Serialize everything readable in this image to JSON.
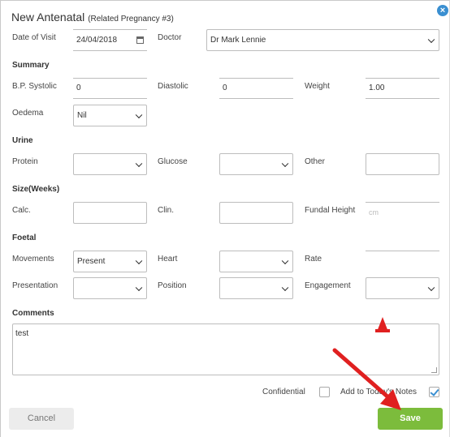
{
  "dialog": {
    "title": "New Antenatal",
    "subtitle": "(Related Pregnancy #3)"
  },
  "visit": {
    "date_label": "Date of Visit",
    "date_value": "24/04/2018",
    "doctor_label": "Doctor",
    "doctor_value": "Dr Mark Lennie"
  },
  "summary": {
    "heading": "Summary",
    "bp_label": "B.P. Systolic",
    "bp_value": "0",
    "diastolic_label": "Diastolic",
    "diastolic_value": "0",
    "weight_label": "Weight",
    "weight_value": "1.00",
    "oedema_label": "Oedema",
    "oedema_value": "Nil"
  },
  "urine": {
    "heading": "Urine",
    "protein_label": "Protein",
    "protein_value": "",
    "glucose_label": "Glucose",
    "glucose_value": "",
    "other_label": "Other",
    "other_value": ""
  },
  "size": {
    "heading": "Size(Weeks)",
    "calc_label": "Calc.",
    "calc_value": "",
    "clin_label": "Clin.",
    "clin_value": "",
    "fundal_label": "Fundal Height",
    "fundal_placeholder": "cm"
  },
  "foetal": {
    "heading": "Foetal",
    "movements_label": "Movements",
    "movements_value": "Present",
    "heart_label": "Heart",
    "heart_value": "",
    "rate_label": "Rate",
    "rate_value": "",
    "presentation_label": "Presentation",
    "presentation_value": "",
    "position_label": "Position",
    "position_value": "",
    "engagement_label": "Engagement",
    "engagement_value": ""
  },
  "comments": {
    "heading": "Comments",
    "value": "test"
  },
  "footer": {
    "confidential_label": "Confidential",
    "confidential_checked": false,
    "notes_label": "Add to Today's Notes",
    "notes_checked": true,
    "cancel_label": "Cancel",
    "save_label": "Save"
  },
  "colors": {
    "save_bg": "#7cbc3c",
    "accent": "#3a8fd1",
    "arrow": "#e02020"
  }
}
